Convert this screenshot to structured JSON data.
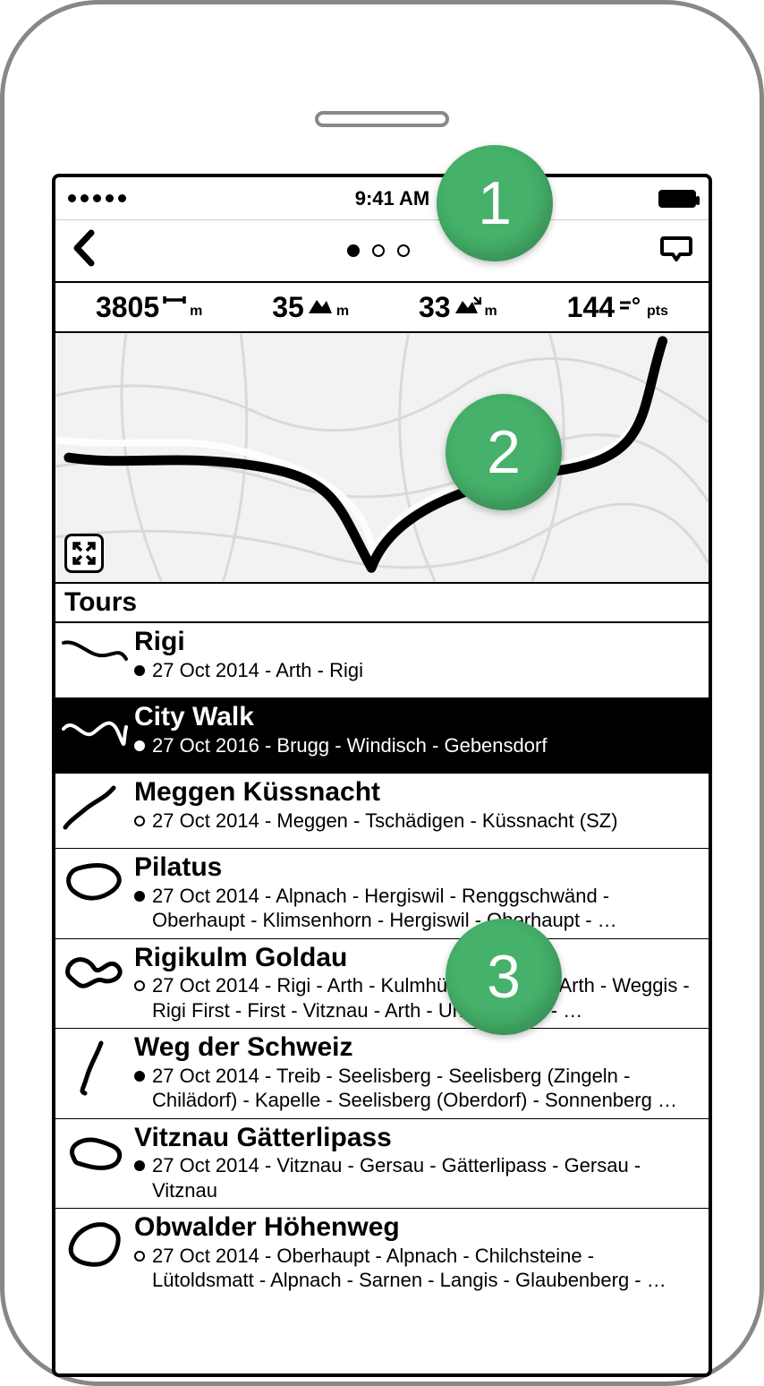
{
  "status": {
    "time": "9:41 AM",
    "signal_dots": 5
  },
  "nav": {
    "page_indicator": {
      "total": 3,
      "active": 0
    }
  },
  "stats": {
    "distance": {
      "value": "3805",
      "unit": "m",
      "icon": "distance"
    },
    "ascent": {
      "value": "35",
      "unit": "m",
      "icon": "ascent"
    },
    "descent": {
      "value": "33",
      "unit": "m",
      "icon": "descent"
    },
    "points": {
      "value": "144",
      "unit": "pts",
      "icon": "points"
    }
  },
  "section_title": "Tours",
  "tours": [
    {
      "title": "Rigi",
      "bullet": "filled",
      "meta": "27 Oct 2014 - Arth - Rigi",
      "selected": false
    },
    {
      "title": "City Walk",
      "bullet": "filled",
      "meta": "27 Oct 2016 - Brugg - Windisch - Gebensdorf",
      "selected": true
    },
    {
      "title": "Meggen Küssnacht",
      "bullet": "hollow",
      "meta": "27 Oct 2014 - Meggen - Tschädigen - Küssnacht (SZ)",
      "selected": false
    },
    {
      "title": "Pilatus",
      "bullet": "filled",
      "meta": "27 Oct 2014 - Alpnach - Hergiswil - Renggschwänd - Oberhaupt - Klimsenhorn - Hergiswil - Oberhaupt - …",
      "selected": false
    },
    {
      "title": "Rigikulm Goldau",
      "bullet": "hollow",
      "meta": "27 Oct 2014 - Rigi - Arth - Kulmhütte - Staffel - Arth - Weggis - Rigi First - First - Vitznau - Arth - Unterstetten - …",
      "selected": false
    },
    {
      "title": "Weg der Schweiz",
      "bullet": "filled",
      "meta": "27 Oct 2014 - Treib - Seelisberg - Seelisberg (Zingeln - Chilädorf) - Kapelle - Seelisberg (Oberdorf) - Sonnenberg …",
      "selected": false
    },
    {
      "title": "Vitznau Gätterlipass",
      "bullet": "filled",
      "meta": "27 Oct 2014 - Vitznau - Gersau - Gätterlipass - Gersau - Vitznau",
      "selected": false
    },
    {
      "title": "Obwalder Höhenweg",
      "bullet": "hollow",
      "meta": "27 Oct 2014 - Oberhaupt - Alpnach - Chilchsteine - Lütoldsmatt - Alpnach - Sarnen - Langis - Glaubenberg - …",
      "selected": false
    }
  ],
  "annotations": {
    "a1": "1",
    "a2": "2",
    "a3": "3"
  },
  "colors": {
    "accent": "#45b16a"
  }
}
